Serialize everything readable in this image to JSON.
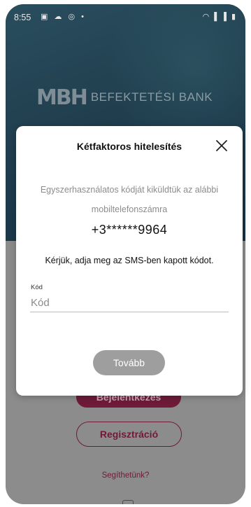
{
  "status_bar": {
    "time": "8:55",
    "left_icons": "▣ ☁ ◎ •",
    "right_icons": "◠ ▌▐ ▮"
  },
  "brand": {
    "mark": "MBH",
    "name": "BEFEKTETÉSI BANK"
  },
  "background": {
    "login_label": "Bejelentkezés",
    "register_label": "Regisztráció",
    "help_label": "Segíthetünk?"
  },
  "modal": {
    "title": "Kétfaktoros hitelesítés",
    "info_line1": "Egyszerhasználatos kódját kiküldtük az alábbi",
    "info_line2": "mobiltelefonszámra",
    "phone": "+3******9964",
    "instruction": "Kérjük, adja meg az SMS-ben kapott kódot.",
    "field_label": "Kód",
    "field_placeholder": "Kód",
    "field_value": "",
    "next_label": "Tovább"
  },
  "colors": {
    "brand_burgundy": "#6e1a38",
    "hero_teal": "#203e4e",
    "disabled_button": "#9e9e9e"
  }
}
